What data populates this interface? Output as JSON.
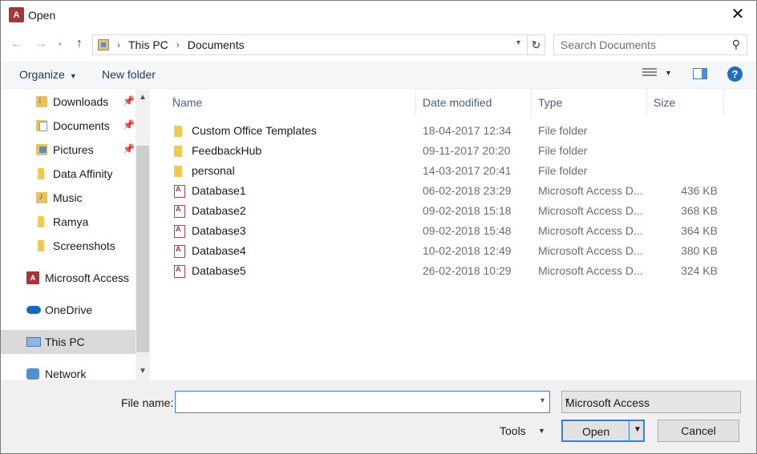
{
  "window": {
    "title": "Open",
    "app_icon": "access-icon",
    "close_glyph": "✕"
  },
  "address": {
    "back_glyph": "←",
    "forward_glyph": "→",
    "up_glyph": "↑",
    "crumbs": [
      "This PC",
      "Documents"
    ],
    "separator": "›",
    "refresh_glyph": "↻"
  },
  "search": {
    "placeholder": "Search Documents"
  },
  "toolbar": {
    "organize": "Organize",
    "new_folder": "New folder",
    "help": "?"
  },
  "sidebar": {
    "items": [
      {
        "label": "Downloads",
        "icon": "downloads-icon",
        "pinned": true
      },
      {
        "label": "Documents",
        "icon": "documents-icon",
        "pinned": true
      },
      {
        "label": "Pictures",
        "icon": "pictures-icon",
        "pinned": true
      },
      {
        "label": "Data Affinity",
        "icon": "folder-icon",
        "pinned": false
      },
      {
        "label": "Music",
        "icon": "music-icon",
        "pinned": false
      },
      {
        "label": "Ramya",
        "icon": "folder-icon",
        "pinned": false
      },
      {
        "label": "Screenshots",
        "icon": "folder-icon",
        "pinned": false
      },
      {
        "label": "Microsoft Access",
        "icon": "access-icon",
        "pinned": false
      },
      {
        "label": "OneDrive",
        "icon": "onedrive-icon",
        "pinned": false
      },
      {
        "label": "This PC",
        "icon": "this-pc-icon",
        "pinned": false,
        "selected": true
      },
      {
        "label": "Network",
        "icon": "network-icon",
        "pinned": false
      }
    ]
  },
  "columns": {
    "name": "Name",
    "date": "Date modified",
    "type": "Type",
    "size": "Size"
  },
  "files": [
    {
      "name": "Custom Office Templates",
      "date": "18-04-2017 12:34",
      "type": "File folder",
      "size": "",
      "kind": "folder"
    },
    {
      "name": "FeedbackHub",
      "date": "09-11-2017 20:20",
      "type": "File folder",
      "size": "",
      "kind": "folder"
    },
    {
      "name": "personal",
      "date": "14-03-2017 20:41",
      "type": "File folder",
      "size": "",
      "kind": "folder"
    },
    {
      "name": "Database1",
      "date": "06-02-2018 23:29",
      "type": "Microsoft Access D...",
      "size": "436 KB",
      "kind": "access"
    },
    {
      "name": "Database2",
      "date": "09-02-2018 15:18",
      "type": "Microsoft Access D...",
      "size": "368 KB",
      "kind": "access"
    },
    {
      "name": "Database3",
      "date": "09-02-2018 15:48",
      "type": "Microsoft Access D...",
      "size": "364 KB",
      "kind": "access"
    },
    {
      "name": "Database4",
      "date": "10-02-2018 12:49",
      "type": "Microsoft Access D...",
      "size": "380 KB",
      "kind": "access"
    },
    {
      "name": "Database5",
      "date": "26-02-2018 10:29",
      "type": "Microsoft Access D...",
      "size": "324 KB",
      "kind": "access"
    }
  ],
  "footer": {
    "file_name_label": "File name:",
    "file_name_value": "",
    "file_type": "Microsoft Access",
    "tools": "Tools",
    "open": "Open",
    "cancel": "Cancel"
  }
}
